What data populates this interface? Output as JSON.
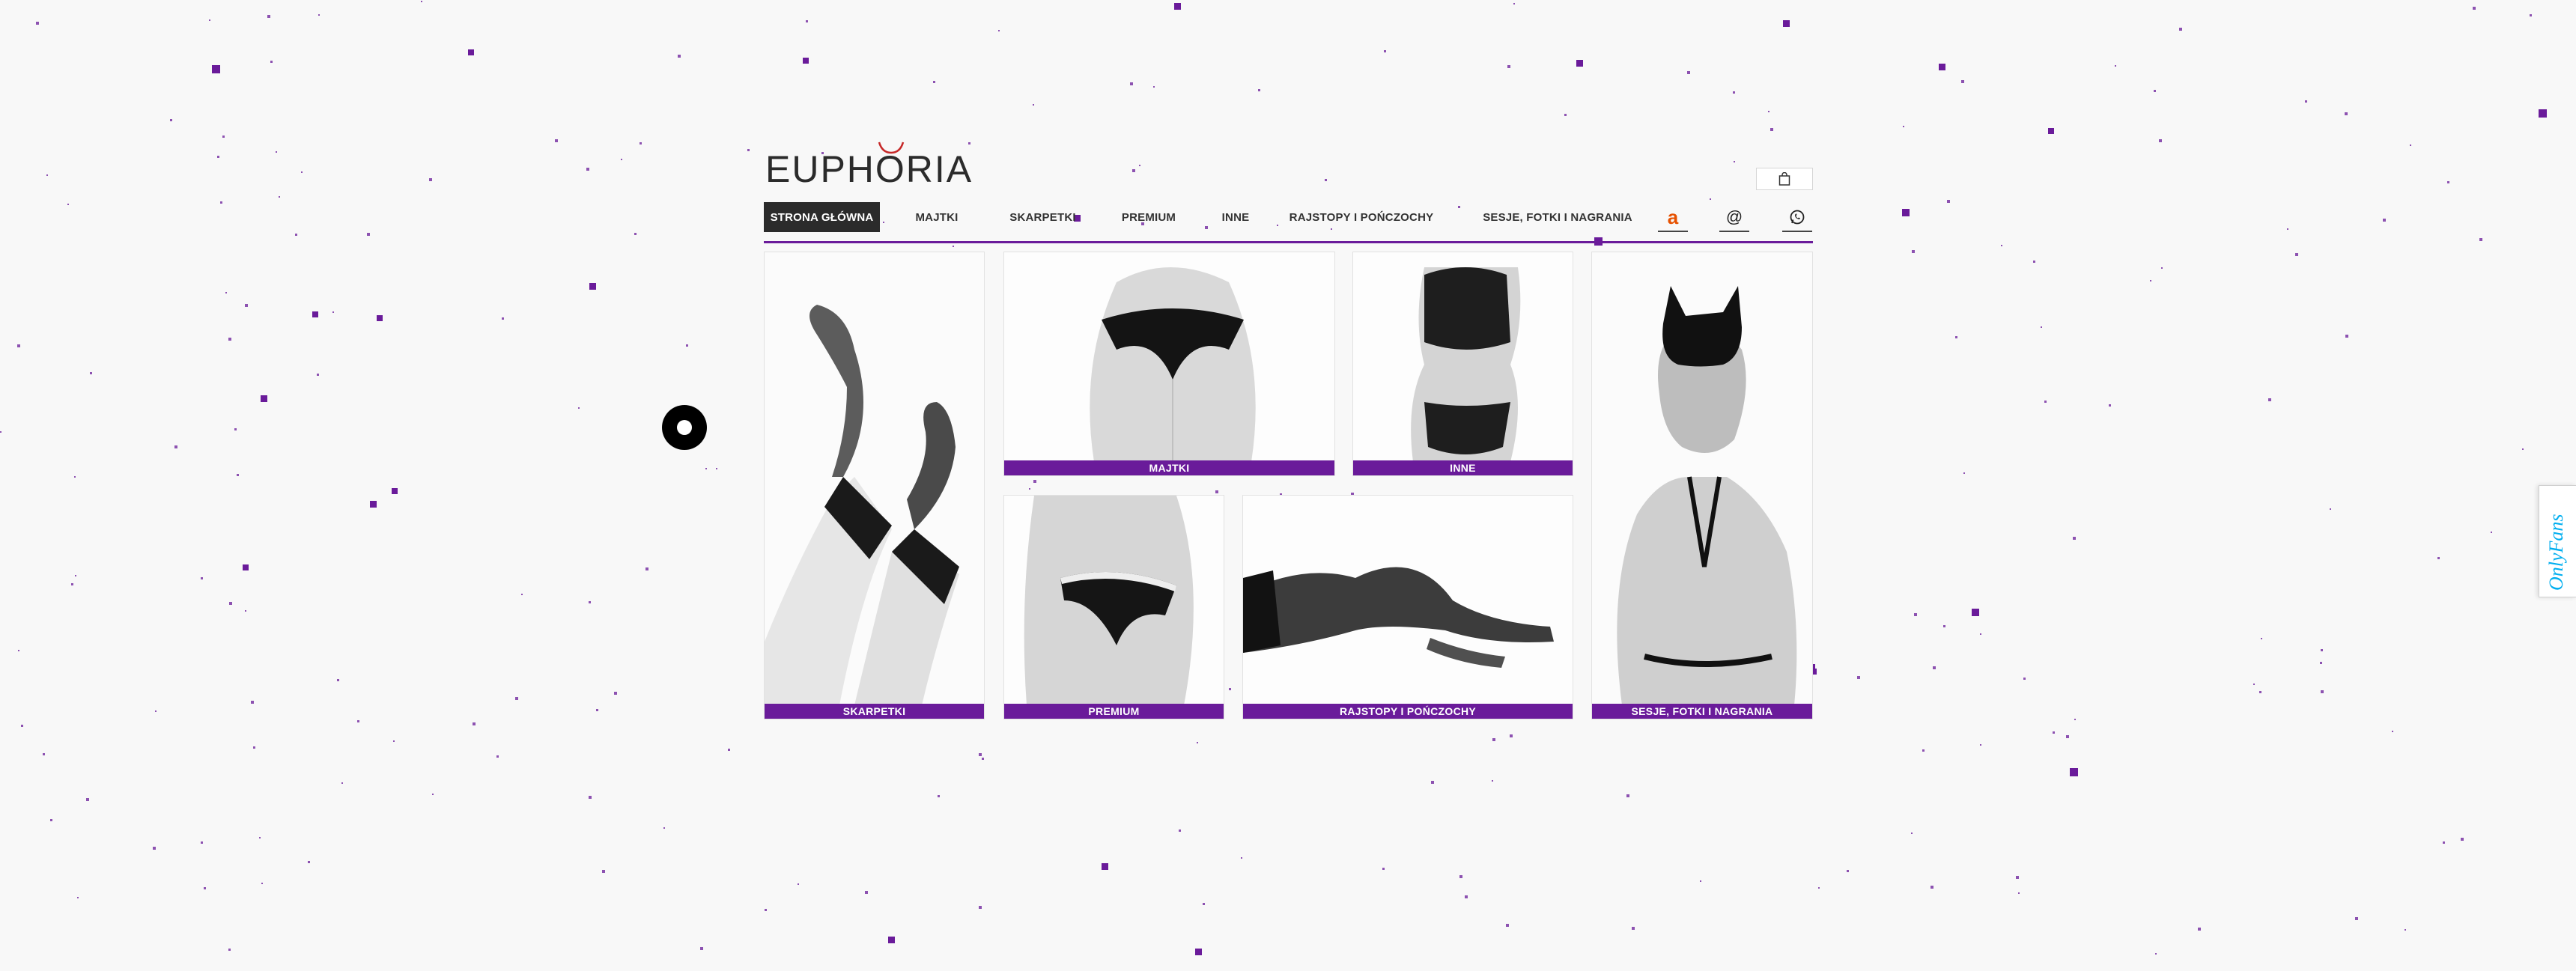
{
  "brand": {
    "logo_text": "EUPHORIA",
    "accent_color": "#6a1b9a"
  },
  "header": {
    "cart_icon": "shopping-bag-icon"
  },
  "nav": {
    "items": [
      {
        "label": "STRONA GŁÓWNA",
        "active": true
      },
      {
        "label": "MAJTKI"
      },
      {
        "label": "SKARPETKI"
      },
      {
        "label": "PREMIUM"
      },
      {
        "label": "INNE"
      },
      {
        "label": "RAJSTOPY I POŃCZOCHY"
      },
      {
        "label": "SESJE, FOTKI I NAGRANIA"
      }
    ],
    "social": [
      {
        "icon": "amazon-icon",
        "glyph": "a"
      },
      {
        "icon": "email-icon",
        "glyph": "@"
      },
      {
        "icon": "whatsapp-icon",
        "glyph": "✆"
      }
    ]
  },
  "tiles": {
    "skarpetki": "SKARPETKI",
    "majtki": "MAJTKI",
    "inne": "INNE",
    "premium": "PREMIUM",
    "rajstopy": "RAJSTOPY I POŃCZOCHY",
    "sesje": "SESJE, FOTKI I NAGRANIA"
  },
  "side_tab": {
    "text": "OnlyFans"
  }
}
